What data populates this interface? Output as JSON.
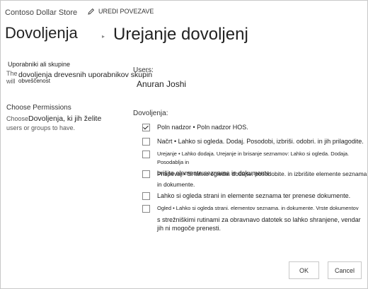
{
  "header": {
    "site_title": "Contoso Dollar Store",
    "edit_links": "UREDI POVEZAVE",
    "breadcrumb_root": "Dovoljenja",
    "breadcrumb_separator": "▸",
    "page_title": "Urejanje dovoljenj"
  },
  "users_section": {
    "title": "Uporabniki ali skupine",
    "desc_prefix": "The",
    "desc_main": "dovoljenja drevesnih uporabnikov skupin",
    "desc_suffix_will": "will",
    "desc_suffix": "obveščenost",
    "users_label": "Users:",
    "users_value": "Anuran Joshi"
  },
  "permissions_section": {
    "title": "Choose Permissions",
    "desc_choose": "Choose",
    "desc_main": "Dovoljenja, ki jih želite",
    "desc_line2": "users or groups to have.",
    "label": "Dovoljenja:",
    "items": [
      {
        "checked": true,
        "text": "Poln nadzor • Poln nadzor HOS."
      },
      {
        "checked": false,
        "text": "Načrt • Lahko si ogleda. Dodaj. Posodobi, izbriši. odobri. in jih prilagodite."
      },
      {
        "checked": false,
        "text_small": "Urejanje • Lahko dodaja. Urejanje in brisanje seznamov: Lahko si ogleda. Dodaja. Posodablja in",
        "text2": "brišite elemente seznama in dokumente."
      },
      {
        "checked": false,
        "text": "Prispevaj • Si lahko ogleda. dodajte. posodobite. in izbrišite elemente seznama",
        "text2": "in dokumente."
      },
      {
        "checked": false,
        "text": "Lahko si ogleda strani in elemente seznama ter prenese dokumente."
      },
      {
        "checked": false,
        "text_small": "Ogled • Lahko si ogleda strani. elementov seznama. in dokumente. Vrste dokumentov",
        "text2": "s strežniškimi rutinami za obravnavo datotek so lahko shranjene, vendar",
        "text3": "jih ni mogoče prenesti."
      }
    ]
  },
  "buttons": {
    "ok": "OK",
    "cancel": "Cancel"
  }
}
